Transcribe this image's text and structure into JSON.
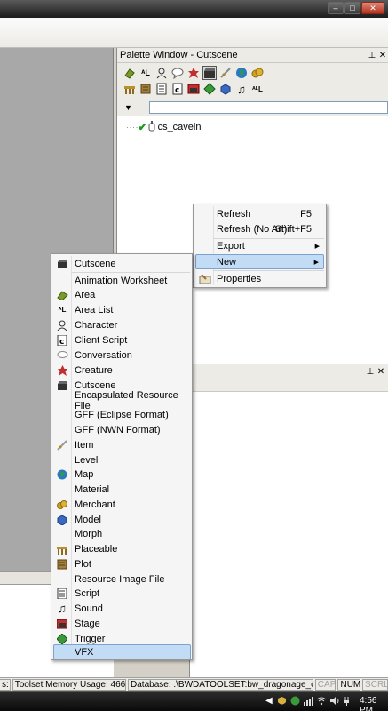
{
  "window": {
    "min": "–",
    "max": "□",
    "close": "✕"
  },
  "palette": {
    "title": "Palette Window - Cutscene",
    "pin": "📌",
    "close": "✕",
    "toolbar_row1": [
      "area-icon",
      "area-list-icon",
      "character-icon",
      "conversation-icon",
      "creature-icon",
      "cutscene-icon",
      "item-icon",
      "map-icon",
      "merchant-icon"
    ],
    "toolbar_row2": [
      "placeable-icon",
      "plot-icon",
      "script-icon",
      "client-script-icon",
      "stage-icon",
      "trigger-icon",
      "model-icon",
      "sound-icon",
      "area-list-icon-2"
    ],
    "dropdown_arrow": "▼",
    "tree": [
      {
        "label": "cs_cavein"
      }
    ]
  },
  "lower_panel": {
    "pin": "📌",
    "close": "✕"
  },
  "context_menu": {
    "items": [
      {
        "label": "Refresh",
        "shortcut": "F5"
      },
      {
        "label": "Refresh (No Art)",
        "shortcut": "Shift+F5"
      },
      {
        "label": "Export",
        "arrow": "▶"
      },
      {
        "label": "New",
        "arrow": "▶"
      },
      {
        "label": "Properties"
      }
    ]
  },
  "submenu": {
    "items": [
      "Cutscene",
      "Animation Worksheet",
      "Area",
      "Area List",
      "Character",
      "Client Script",
      "Conversation",
      "Creature",
      "Cutscene",
      "Encapsulated Resource File",
      "GFF (Eclipse Format)",
      "GFF (NWN Format)",
      "Item",
      "Level",
      "Map",
      "Material",
      "Merchant",
      "Model",
      "Morph",
      "Placeable",
      "Plot",
      "Resource Image File",
      "Script",
      "Sound",
      "Stage",
      "Trigger",
      "VFX"
    ]
  },
  "status_bar": {
    "left_fragment": "s:",
    "memory": "Toolset Memory Usage: 466 MB",
    "database": "Database: .\\BWDATOOLSET:bw_dragonage_content",
    "cap": "CAP",
    "num": "NUM",
    "scrl": "SCRL"
  },
  "taskbar": {
    "clock": "4:56 PM",
    "tray_arrow": "◀"
  }
}
